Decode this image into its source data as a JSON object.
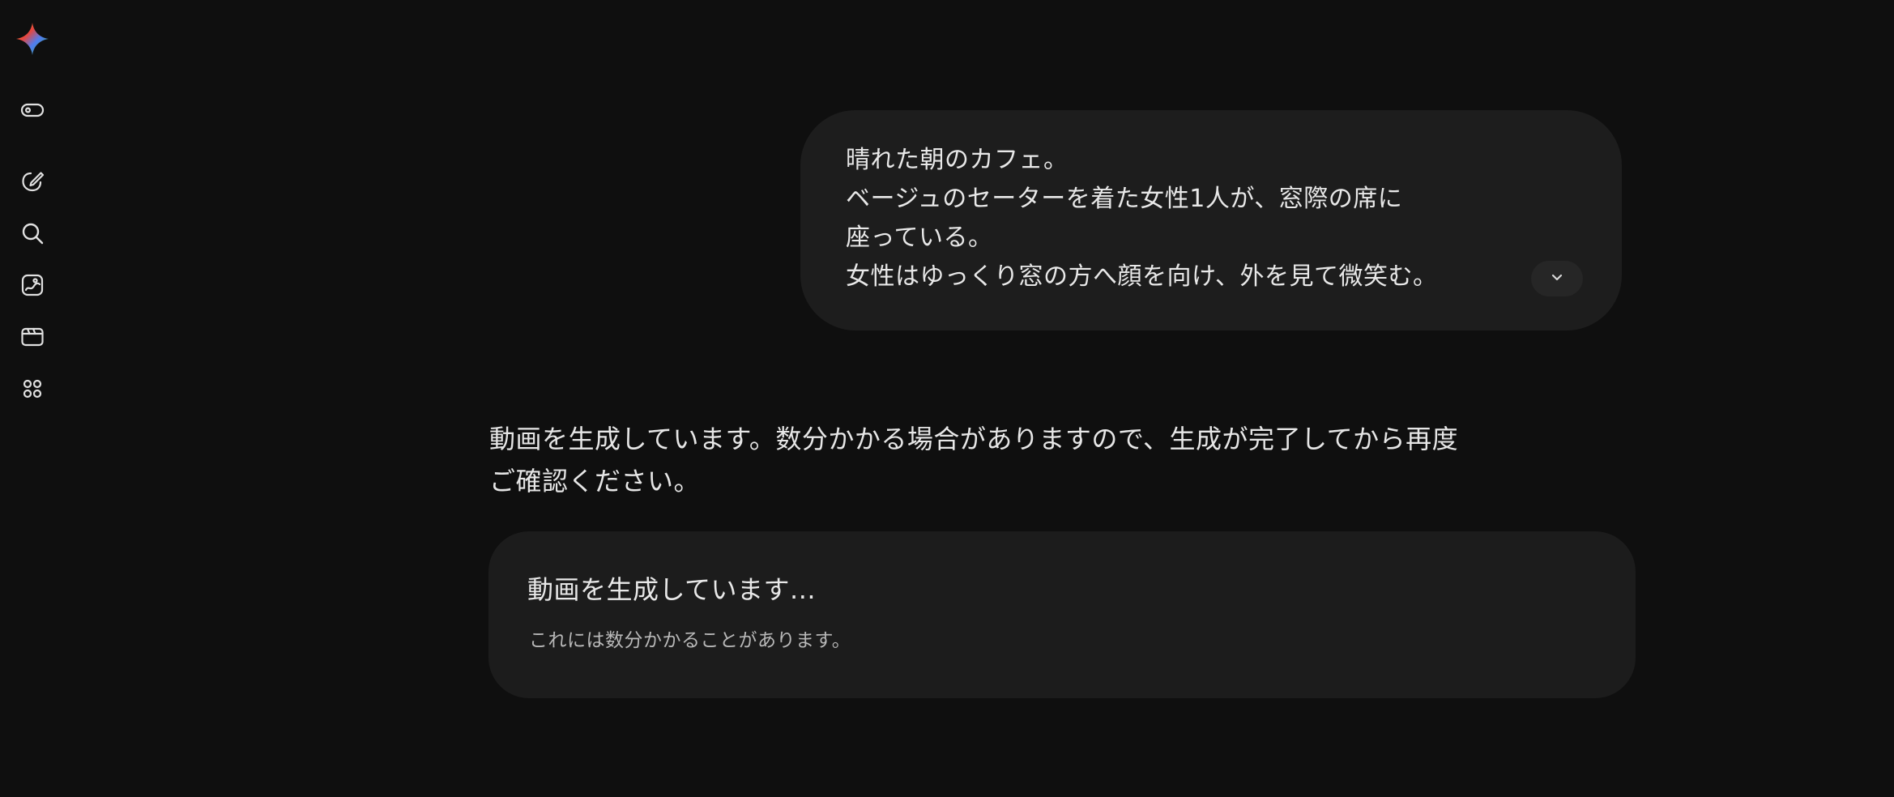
{
  "sidebar": {
    "items": [
      {
        "name": "gemini-logo",
        "icon": "gemini-sparkle-icon"
      },
      {
        "name": "toggle-sidebar",
        "icon": "toggle-icon"
      },
      {
        "name": "new-chat",
        "icon": "edit-pen-icon"
      },
      {
        "name": "search",
        "icon": "search-icon"
      },
      {
        "name": "gallery",
        "icon": "image-gallery-icon"
      },
      {
        "name": "videos",
        "icon": "video-clapper-icon"
      },
      {
        "name": "apps",
        "icon": "apps-grid-icon"
      }
    ]
  },
  "conversation": {
    "user_message": {
      "lines": [
        "晴れた朝のカフェ。",
        "ベージュのセーターを着た女性1人が、窓際の席に",
        "座っている。",
        "女性はゆっくり窓の方へ顔を向け、外を見て微笑む。"
      ],
      "expand_icon": "chevron-down-icon"
    },
    "response": {
      "lines": [
        "動画を生成しています。数分かかる場合がありますので、生成が完了してから再度",
        "ご確認ください。"
      ]
    },
    "status_card": {
      "title": "動画を生成しています...",
      "subtitle": "これには数分かかることがあります。"
    }
  },
  "colors": {
    "background": "#0f0f0f",
    "bubble": "#1d1d1d",
    "card": "#1c1c1c",
    "text": "#e6e6e6",
    "muted_text": "#b8b8b8"
  }
}
